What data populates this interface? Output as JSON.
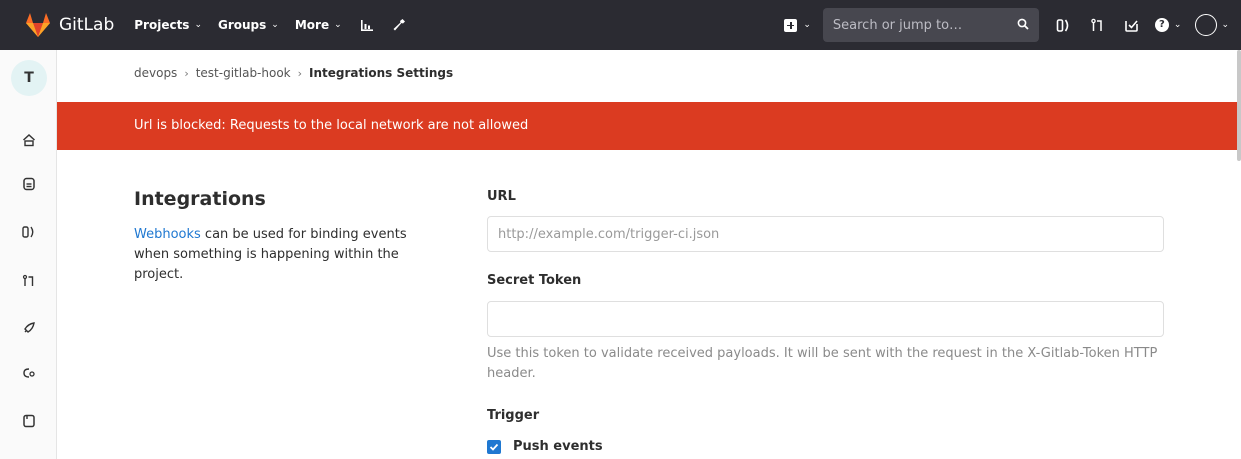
{
  "topnav": {
    "brand": "GitLab",
    "menu": [
      {
        "label": "Projects",
        "name": "nav-projects"
      },
      {
        "label": "Groups",
        "name": "nav-groups"
      },
      {
        "label": "More",
        "name": "nav-more"
      }
    ],
    "search_placeholder": "Search or jump to…",
    "colors": {
      "background": "#2b2b32",
      "brand_orange": "#fc6d26"
    }
  },
  "sidebar": {
    "project_initial": "T",
    "icons": [
      "home-icon",
      "issues-icon",
      "merge-requests-icon",
      "ci-cd-icon",
      "operations-icon",
      "settings-icon",
      "wiki-icon"
    ]
  },
  "breadcrumb": {
    "group": "devops",
    "project": "test-gitlab-hook",
    "current": "Integrations Settings"
  },
  "alert": {
    "message": "Url is blocked: Requests to the local network are not allowed",
    "color": "#db3b21"
  },
  "settings": {
    "title": "Integrations",
    "desc_link": "Webhooks",
    "desc_rest": " can be used for binding events when something is happening within the project."
  },
  "form": {
    "url_label": "URL",
    "url_placeholder": "http://example.com/trigger-ci.json",
    "url_value": "",
    "secret_label": "Secret Token",
    "secret_value": "",
    "secret_help": "Use this token to validate received payloads. It will be sent with the request in the X-Gitlab-Token HTTP header.",
    "trigger_label": "Trigger",
    "triggers": [
      {
        "label": "Push events",
        "checked": true
      }
    ]
  }
}
